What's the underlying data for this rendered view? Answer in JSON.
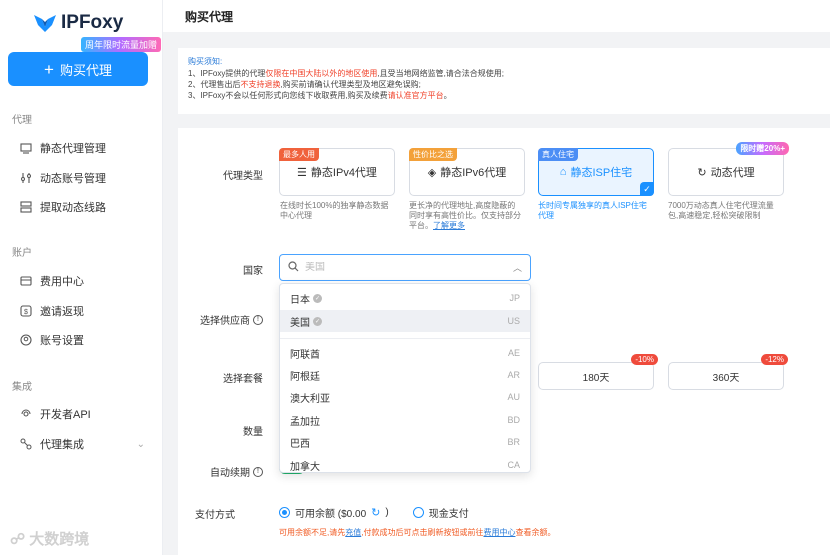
{
  "app": {
    "logo_text": "IPFoxy",
    "promo_tag": "周年限时流量加赠"
  },
  "sidebar": {
    "buy_button": "购买代理",
    "groups": [
      {
        "title": "代理",
        "items": [
          {
            "label": "静态代理管理"
          },
          {
            "label": "动态账号管理"
          },
          {
            "label": "提取动态线路"
          }
        ]
      },
      {
        "title": "账户",
        "items": [
          {
            "label": "费用中心"
          },
          {
            "label": "邀请返现"
          },
          {
            "label": "账号设置"
          }
        ]
      },
      {
        "title": "集成",
        "items": [
          {
            "label": "开发者API"
          },
          {
            "label": "代理集成"
          }
        ]
      }
    ]
  },
  "header": {
    "title": "购买代理"
  },
  "notice": {
    "title": "购买须知:",
    "line1_a": "1、IPFoxy提供的代理",
    "line1_red": "仅限在中国大陆以外的地区使用",
    "line1_b": ",且受当地网络监管,请合法合规使用;",
    "line2_a": "2、代理售出后",
    "line2_red": "不支持退换",
    "line2_b": ",购买前请确认代理类型及地区避免误购;",
    "line3_a": "3、IPFoxy不会以任何形式向您线下收取费用,购买及续费",
    "line3_red": "请认准官方平台",
    "line3_b": "。"
  },
  "form": {
    "proxy_type_label": "代理类型",
    "country_label": "国家",
    "supplier_label": "选择供应商",
    "plan_label": "选择套餐",
    "quantity_label": "数量",
    "auto_renew_label": "自动续期",
    "payment_label": "支付方式"
  },
  "proxy_types": [
    {
      "tag": "最多人用",
      "tag_color": "#f0623c",
      "label": "静态IPv4代理",
      "desc": "在线时长100%的独享静态数据中心代理"
    },
    {
      "tag": "性价比之选",
      "tag_color": "#f3a13a",
      "label": "静态IPv6代理",
      "desc": "更长净的代理地址,高度隐蔽的同时享有高性价比。仅支持部分平台。",
      "desc_link": "了解更多"
    },
    {
      "tag": "真人住宅",
      "tag_color": "#4c8ef5",
      "label": "静态ISP住宅",
      "desc": "长时间专属独享的真人ISP住宅代理",
      "selected": true
    },
    {
      "badge": "限时赠20%+",
      "label": "动态代理",
      "desc": "7000万动态真人住宅代理流量包,高速稳定,轻松突破限制"
    }
  ],
  "country_search": {
    "placeholder": "美国",
    "value": ""
  },
  "countries": [
    {
      "name": "日本",
      "code": "JP",
      "checked": true
    },
    {
      "name": "美国",
      "code": "US",
      "checked": true,
      "highlighted": true
    },
    {
      "name": "阿联酋",
      "code": "AE"
    },
    {
      "name": "阿根廷",
      "code": "AR"
    },
    {
      "name": "澳大利亚",
      "code": "AU"
    },
    {
      "name": "孟加拉",
      "code": "BD"
    },
    {
      "name": "巴西",
      "code": "BR"
    },
    {
      "name": "加拿大",
      "code": "CA"
    }
  ],
  "durations": [
    {
      "label": "180天",
      "discount": "-10%"
    },
    {
      "label": "360天",
      "discount": "-12%"
    }
  ],
  "payment": {
    "option1": "可用余额 ($0.00",
    "option1_close": ")",
    "option2": "现金支付",
    "note_a": "可用余额不足,请先",
    "note_link1": "充值",
    "note_b": ",付款成功后可点击刷新按钮或前往",
    "note_link2": "费用中心",
    "note_c": "查看余额。"
  },
  "watermark": "大数跨境",
  "colors": {
    "accent": "#1a90ff",
    "warning": "#f0422a",
    "toggle_on": "#20b26b"
  }
}
